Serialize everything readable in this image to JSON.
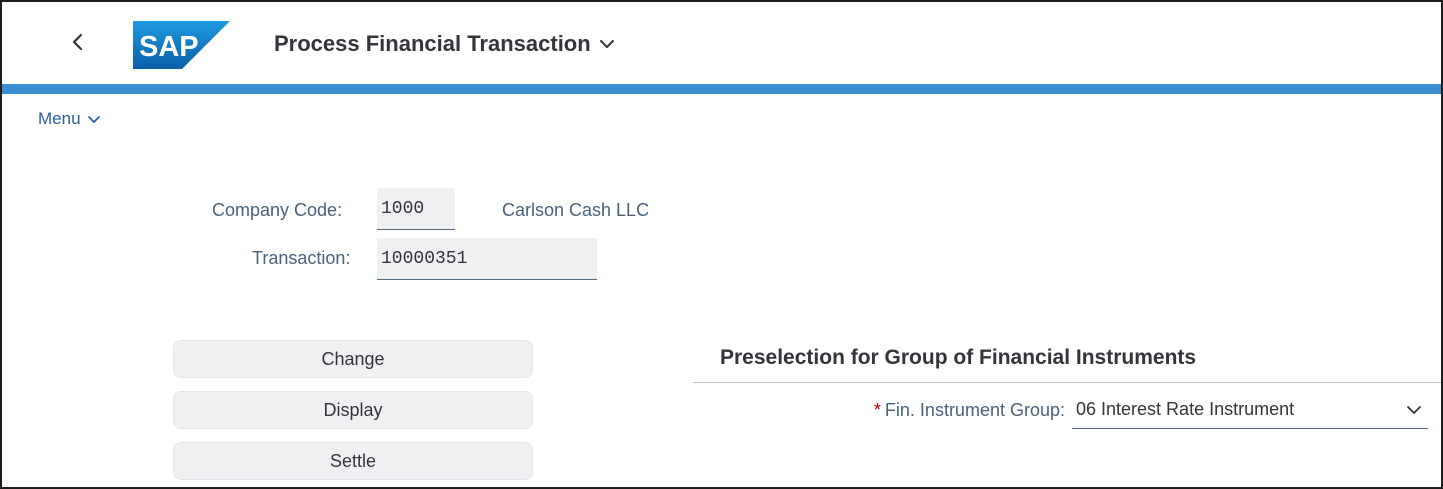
{
  "shell": {
    "title": "Process Financial Transaction",
    "logo_text": "SAP",
    "accent_color": "#3a8fd2"
  },
  "menu": {
    "label": "Menu"
  },
  "form": {
    "company_code": {
      "label": "Company Code:",
      "value": "1000",
      "description": "Carlson Cash LLC"
    },
    "transaction": {
      "label": "Transaction:",
      "value": "10000351"
    }
  },
  "actions": {
    "change": "Change",
    "display": "Display",
    "settle": "Settle"
  },
  "preselection": {
    "title": "Preselection for Group of Financial Instruments",
    "fin_instrument_group": {
      "required_mark": "*",
      "label": "Fin. Instrument Group:",
      "value": "06 Interest Rate Instrument"
    }
  },
  "icons": {
    "back": "back-icon",
    "title_chevron": "chevron-down-icon",
    "menu_chevron": "chevron-down-icon",
    "select_chevron": "chevron-down-icon"
  }
}
